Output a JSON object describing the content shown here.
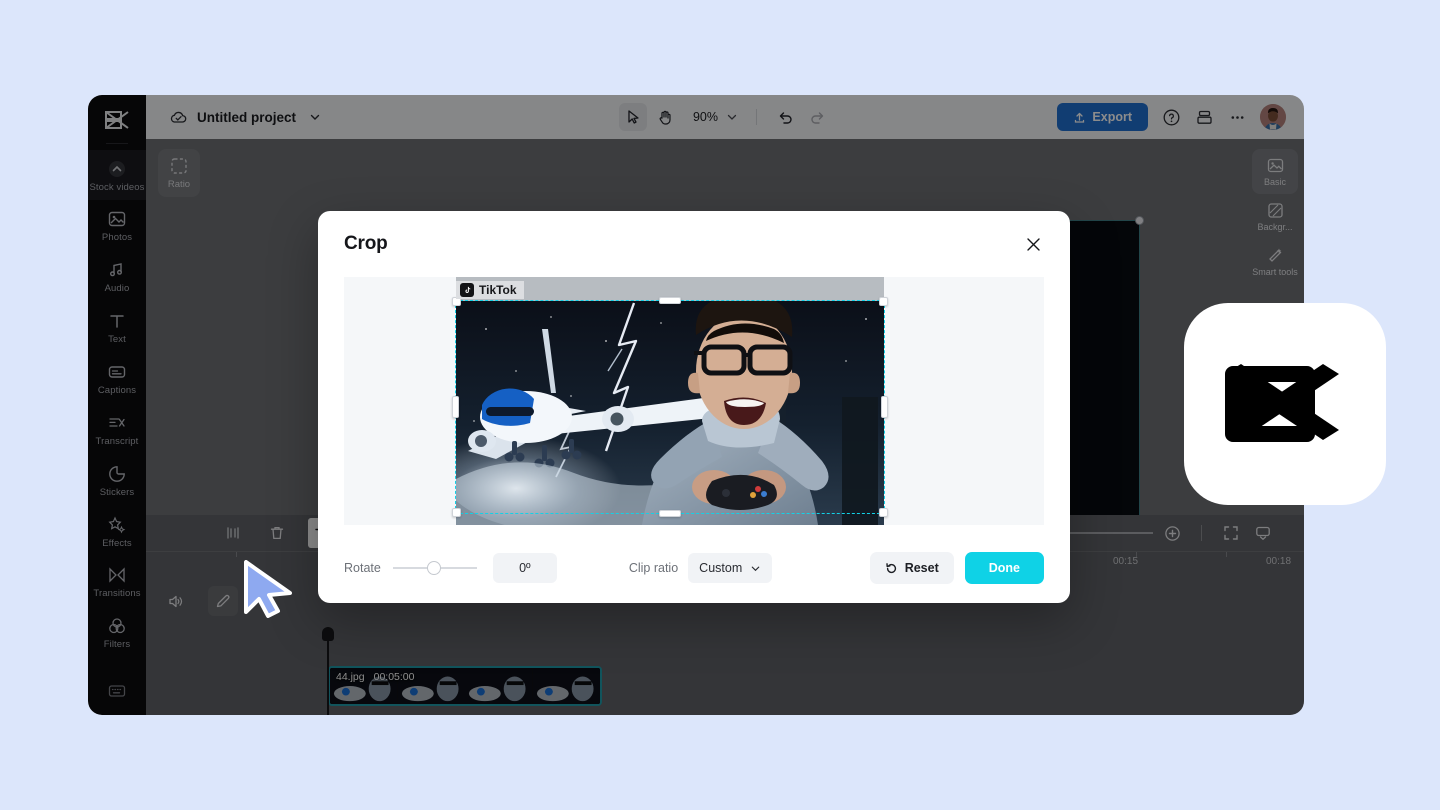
{
  "app": {
    "project_title": "Untitled project",
    "zoom_level": "90%",
    "export_label": "Export"
  },
  "topbar": {
    "icons": [
      "cloud-saved-icon",
      "chevron-down-icon",
      "select-tool-icon",
      "hand-tool-icon",
      "undo-icon",
      "redo-icon",
      "help-icon",
      "layout-icon",
      "more-icon",
      "avatar"
    ]
  },
  "left_rail": {
    "items": [
      {
        "label": "Stock videos",
        "icon": "stock-videos-icon",
        "active": true
      },
      {
        "label": "Photos",
        "icon": "photos-icon",
        "active": false
      },
      {
        "label": "Audio",
        "icon": "audio-icon",
        "active": false
      },
      {
        "label": "Text",
        "icon": "text-icon",
        "active": false
      },
      {
        "label": "Captions",
        "icon": "captions-icon",
        "active": false
      },
      {
        "label": "Transcript",
        "icon": "transcript-icon",
        "active": false
      },
      {
        "label": "Stickers",
        "icon": "stickers-icon",
        "active": false
      },
      {
        "label": "Effects",
        "icon": "effects-icon",
        "active": false
      },
      {
        "label": "Transitions",
        "icon": "transitions-icon",
        "active": false
      },
      {
        "label": "Filters",
        "icon": "filters-icon",
        "active": false
      }
    ],
    "bottom_icon": "keyboard-shortcuts-icon"
  },
  "right_rail": {
    "items": [
      {
        "label": "Basic",
        "icon": "basic-icon"
      },
      {
        "label": "Backgr...",
        "icon": "background-icon"
      },
      {
        "label": "Smart tools",
        "icon": "smart-tools-icon"
      }
    ]
  },
  "stage": {
    "ratio_label": "Ratio",
    "watermark": "TikTok"
  },
  "timeline": {
    "tools": [
      "split-icon",
      "delete-icon",
      "crop-icon",
      "mirror-icon"
    ],
    "right_tools": [
      "snap-icon",
      "zoom-out-icon",
      "zoom-in-icon",
      "fit-icon",
      "render-icon"
    ],
    "ruler_labels": [
      "00:15",
      "00:18"
    ],
    "track_controls": [
      "volume-icon",
      "edit-icon"
    ],
    "clip": {
      "name": "44.jpg",
      "duration": "00:05:00"
    }
  },
  "crop_modal": {
    "title": "Crop",
    "close_icon": "close-icon",
    "watermark": "TikTok",
    "rotate_label": "Rotate",
    "rotate_value": "0º",
    "clip_ratio_label": "Clip ratio",
    "clip_ratio_value": "Custom",
    "reset_label": "Reset",
    "done_label": "Done"
  },
  "colors": {
    "accent_cyan": "#0fd2e6",
    "export_blue": "#1f6fd0",
    "crop_outline": "#12d2e8",
    "page_bg": "#dce6fb"
  }
}
